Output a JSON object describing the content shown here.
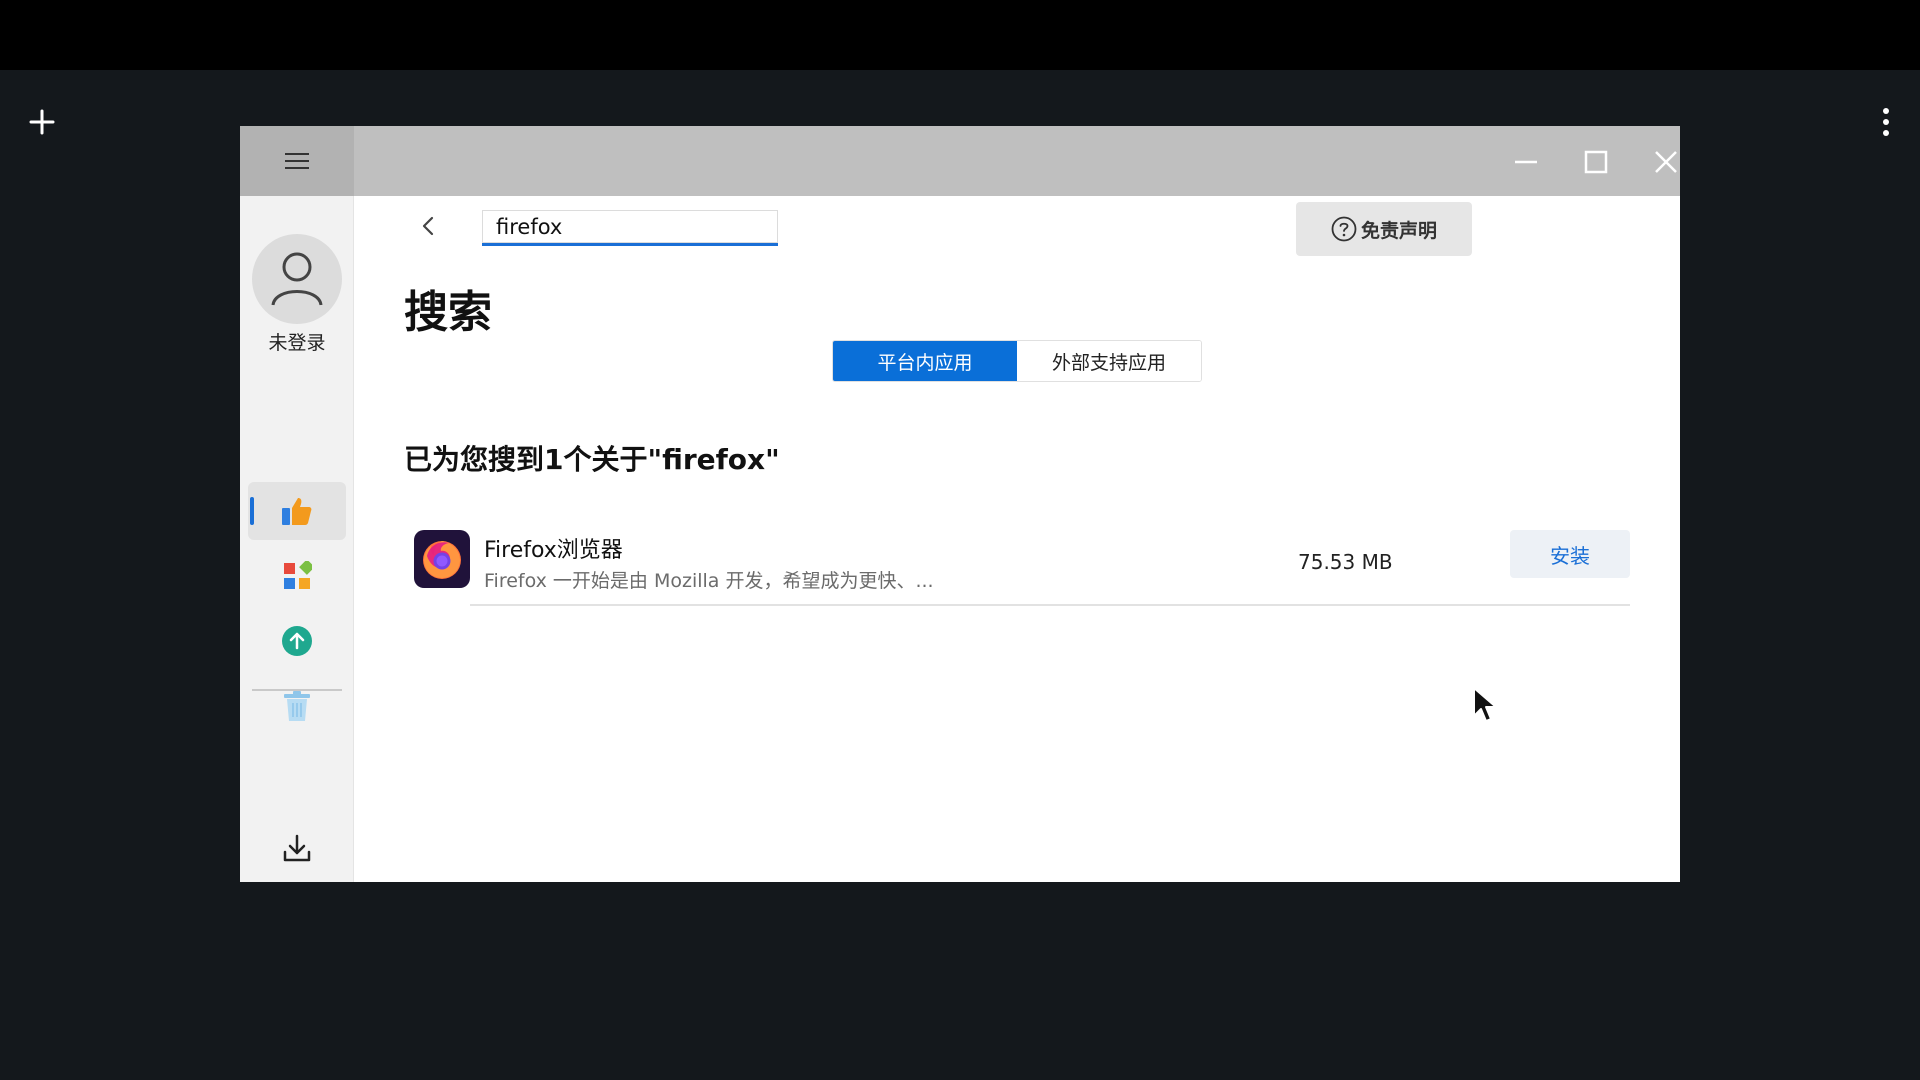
{
  "desktop": {
    "icons": {
      "add": "plus-icon",
      "more": "more-vertical-icon"
    }
  },
  "window": {
    "icons": {
      "menu": "hamburger-icon",
      "minimize": "minimize-icon",
      "maximize": "maximize-icon",
      "close": "close-icon"
    }
  },
  "sidebar": {
    "login_label": "未登录",
    "items": [
      {
        "name": "recommend",
        "icon": "thumbs-up-icon",
        "active": true
      },
      {
        "name": "categories",
        "icon": "grid-apps-icon",
        "active": false
      },
      {
        "name": "updates",
        "icon": "upload-arrow-icon",
        "active": false
      },
      {
        "name": "uninstall",
        "icon": "trash-icon",
        "active": false
      }
    ],
    "download_icon": "download-icon"
  },
  "search": {
    "value": "firefox",
    "back_icon": "chevron-left-icon"
  },
  "disclaimer": {
    "label": "免责声明",
    "icon": "help-circle-icon"
  },
  "page": {
    "title": "搜索"
  },
  "tabs": [
    {
      "label": "平台内应用",
      "active": true
    },
    {
      "label": "外部支持应用",
      "active": false
    }
  ],
  "results": {
    "heading": "已为您搜到1个关于\"firefox\"",
    "items": [
      {
        "name": "Firefox浏览器",
        "description": "Firefox 一开始是由 Mozilla 开发，希望成为更快、...",
        "size": "75.53 MB",
        "action": "安装",
        "icon": "firefox-icon"
      }
    ]
  },
  "colors": {
    "accent": "#0a6fd8",
    "titlebar": "#bfbfbf",
    "desktop": "#14181c"
  }
}
